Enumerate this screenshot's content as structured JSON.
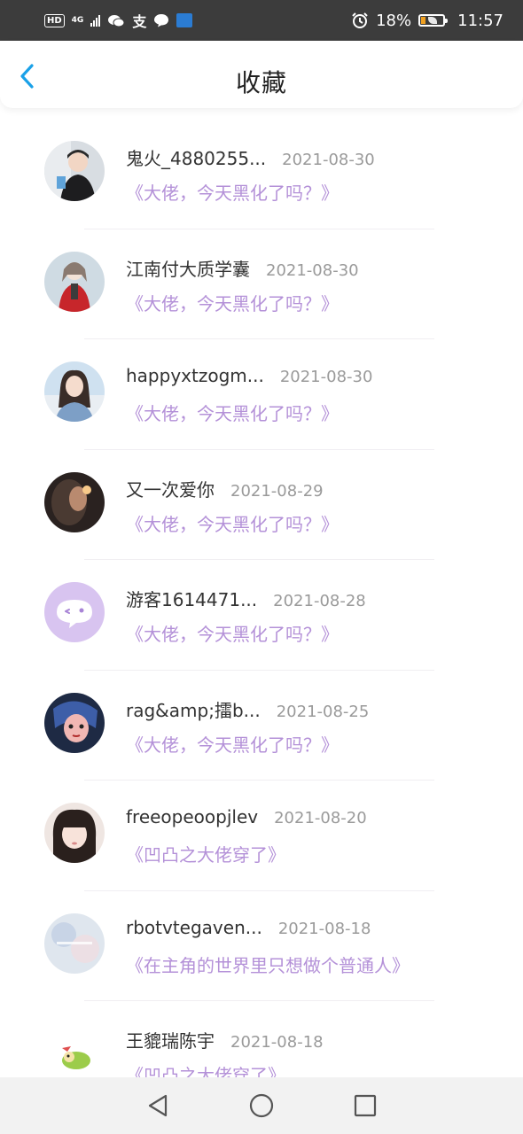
{
  "status_bar": {
    "hd": "HD",
    "network": "4G",
    "pay_glyph": "支",
    "battery_percent": "18%",
    "time": "11:57"
  },
  "header": {
    "title": "收藏",
    "back_icon": "chevron-left-icon",
    "accent_color": "#1aa1e8"
  },
  "colors": {
    "book_title": "#b491d8",
    "date": "#9a9a9a",
    "username": "#333333"
  },
  "favorites": [
    {
      "username": "鬼火_4880255...",
      "date": "2021-08-30",
      "book": "《大佬，今天黑化了吗？》"
    },
    {
      "username": "江南付大质学囊",
      "date": "2021-08-30",
      "book": "《大佬，今天黑化了吗？》"
    },
    {
      "username": "happyxtzogm...",
      "date": "2021-08-30",
      "book": "《大佬，今天黑化了吗？》"
    },
    {
      "username": "又一次爱你",
      "date": "2021-08-29",
      "book": "《大佬，今天黑化了吗？》"
    },
    {
      "username": "游客1614471...",
      "date": "2021-08-28",
      "book": "《大佬，今天黑化了吗？》"
    },
    {
      "username": "rag&amp;擂b...",
      "date": "2021-08-25",
      "book": "《大佬，今天黑化了吗？》"
    },
    {
      "username": "freeopeoopjlev",
      "date": "2021-08-20",
      "book": "《凹凸之大佬穿了》"
    },
    {
      "username": "rbotvtegaven...",
      "date": "2021-08-18",
      "book": "《在主角的世界里只想做个普通人》"
    },
    {
      "username": "王貔瑞陈宇",
      "date": "2021-08-18",
      "book": "《凹凸之大佬穿了》"
    }
  ],
  "system_nav": {
    "back_icon": "triangle-back-icon",
    "home_icon": "circle-home-icon",
    "recents_icon": "square-recents-icon"
  }
}
